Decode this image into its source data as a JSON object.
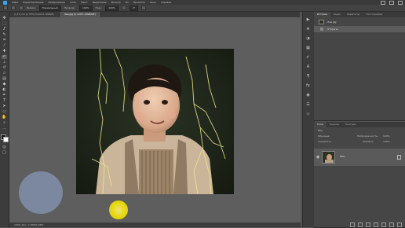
{
  "app": {
    "name": "Photoshop"
  },
  "menu": [
    "Файл",
    "Редактирование",
    "Изображение",
    "Слои",
    "Текст",
    "Выделение",
    "Фильтр",
    "3D",
    "Просмотр",
    "Окно",
    "Справка"
  ],
  "options": {
    "mode_label": "Режим:",
    "mode_value": "Нормальный",
    "opacity_label": "Непрозр.:",
    "opacity_value": "100%",
    "flow_label": "Наж.:",
    "flow_value": "100%",
    "angle_value": "0°"
  },
  "tabs": [
    {
      "label": "2_21 улл @ 33% (Слой 0, RGB/8)",
      "active": false
    },
    {
      "label": "Лев.jpg @ 100% (RGB/8#)",
      "active": true
    }
  ],
  "status": {
    "zoom": "100%",
    "doc": "Док: 1,45M/1,45M"
  },
  "history_panel": {
    "tabs": [
      "История",
      "Инфо",
      "Навигатор",
      "Гистограмма"
    ],
    "items": [
      {
        "label": "Лев.jpg"
      },
      {
        "label": "Открыть"
      }
    ]
  },
  "layers_panel": {
    "tabs": [
      "Слои",
      "Каналы",
      "Контуры"
    ],
    "kind": "Вид",
    "blend": "Обычные",
    "opacity_label": "Непрозрачность:",
    "opacity_value": "100%",
    "lock_label": "Закрепить:",
    "fill_label": "Заливка:",
    "fill_value": "100%",
    "layer_name": "Фон"
  },
  "colors": {
    "accent": "#31a8ff",
    "pointer": "#f4e400"
  }
}
